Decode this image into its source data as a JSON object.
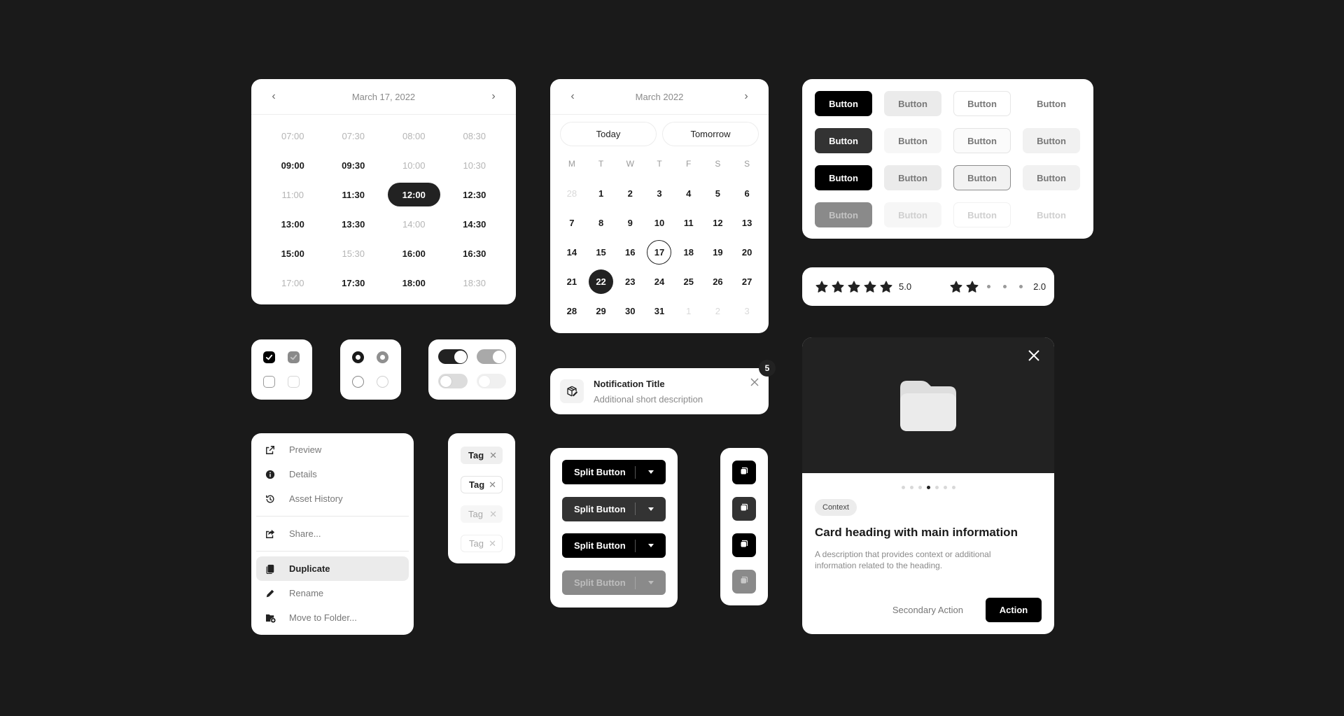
{
  "time_picker": {
    "title": "March 17, 2022",
    "prev_icon": "chevron-left-icon",
    "next_icon": "chevron-right-icon",
    "slots": [
      {
        "time": "07:00",
        "state": "unavailable"
      },
      {
        "time": "07:30",
        "state": "unavailable"
      },
      {
        "time": "08:00",
        "state": "unavailable"
      },
      {
        "time": "08:30",
        "state": "unavailable"
      },
      {
        "time": "09:00",
        "state": "available"
      },
      {
        "time": "09:30",
        "state": "available"
      },
      {
        "time": "10:00",
        "state": "unavailable"
      },
      {
        "time": "10:30",
        "state": "unavailable"
      },
      {
        "time": "11:00",
        "state": "unavailable"
      },
      {
        "time": "11:30",
        "state": "available"
      },
      {
        "time": "12:00",
        "state": "selected"
      },
      {
        "time": "12:30",
        "state": "available"
      },
      {
        "time": "13:00",
        "state": "available"
      },
      {
        "time": "13:30",
        "state": "available"
      },
      {
        "time": "14:00",
        "state": "unavailable"
      },
      {
        "time": "14:30",
        "state": "available"
      },
      {
        "time": "15:00",
        "state": "available"
      },
      {
        "time": "15:30",
        "state": "unavailable"
      },
      {
        "time": "16:00",
        "state": "available"
      },
      {
        "time": "16:30",
        "state": "available"
      },
      {
        "time": "17:00",
        "state": "unavailable"
      },
      {
        "time": "17:30",
        "state": "available"
      },
      {
        "time": "18:00",
        "state": "available"
      },
      {
        "time": "18:30",
        "state": "unavailable"
      }
    ]
  },
  "date_picker": {
    "title": "March 2022",
    "quick": [
      "Today",
      "Tomorrow"
    ],
    "weekdays": [
      "M",
      "T",
      "W",
      "T",
      "F",
      "S",
      "S"
    ],
    "days": [
      {
        "d": "28",
        "s": "muted"
      },
      {
        "d": "1"
      },
      {
        "d": "2"
      },
      {
        "d": "3"
      },
      {
        "d": "4"
      },
      {
        "d": "5"
      },
      {
        "d": "6"
      },
      {
        "d": "7"
      },
      {
        "d": "8"
      },
      {
        "d": "9"
      },
      {
        "d": "10"
      },
      {
        "d": "11"
      },
      {
        "d": "12"
      },
      {
        "d": "13"
      },
      {
        "d": "14"
      },
      {
        "d": "15"
      },
      {
        "d": "16"
      },
      {
        "d": "17",
        "s": "today"
      },
      {
        "d": "18"
      },
      {
        "d": "19"
      },
      {
        "d": "20"
      },
      {
        "d": "21"
      },
      {
        "d": "22",
        "s": "sel"
      },
      {
        "d": "23"
      },
      {
        "d": "24"
      },
      {
        "d": "25"
      },
      {
        "d": "26"
      },
      {
        "d": "27"
      },
      {
        "d": "28"
      },
      {
        "d": "29"
      },
      {
        "d": "30"
      },
      {
        "d": "31"
      },
      {
        "d": "1",
        "s": "muted"
      },
      {
        "d": "2",
        "s": "muted"
      },
      {
        "d": "3",
        "s": "muted"
      }
    ]
  },
  "button_grid": {
    "label": "Button",
    "rows": [
      [
        "primary",
        "secondary",
        "outline",
        "ghost"
      ],
      [
        "primary-hover",
        "secondary-hover",
        "outline-hover",
        "ghost-hover"
      ],
      [
        "primary",
        "secondary",
        "outline-active",
        "ghost-hover"
      ],
      [
        "primary-disabled",
        "secondary-disabled",
        "outline-disabled",
        "ghost-disabled"
      ]
    ]
  },
  "ratings": [
    {
      "value": 5,
      "max": 5,
      "label": "5.0"
    },
    {
      "value": 2,
      "max": 5,
      "label": "2.0"
    }
  ],
  "checkboxes": [
    "checked",
    "checked-disabled",
    "unchecked",
    "unchecked-disabled"
  ],
  "radios": [
    "selected",
    "selected-disabled",
    "unselected",
    "unselected-disabled"
  ],
  "toggles": [
    "on",
    "on-disabled",
    "off",
    "off-disabled"
  ],
  "notification": {
    "title": "Notification Title",
    "description": "Additional short description",
    "badge_count": "5",
    "icon": "package-edit-icon"
  },
  "context_menu": {
    "groups": [
      [
        {
          "label": "Preview",
          "icon": "external-link-icon"
        },
        {
          "label": "Details",
          "icon": "info-icon"
        },
        {
          "label": "Asset History",
          "icon": "history-icon"
        }
      ],
      [
        {
          "label": "Share...",
          "icon": "share-icon"
        }
      ],
      [
        {
          "label": "Duplicate",
          "icon": "duplicate-icon",
          "active": true
        },
        {
          "label": "Rename",
          "icon": "pencil-icon"
        },
        {
          "label": "Move to Folder...",
          "icon": "folder-move-icon"
        }
      ]
    ]
  },
  "tags": [
    {
      "label": "Tag",
      "variant": "filled"
    },
    {
      "label": "Tag",
      "variant": "outline"
    },
    {
      "label": "Tag",
      "variant": "filled-dis"
    },
    {
      "label": "Tag",
      "variant": "outline-dis"
    }
  ],
  "split_buttons": {
    "label": "Split Button",
    "variants": [
      "primary",
      "hover",
      "primary",
      "disabled"
    ]
  },
  "icon_buttons": {
    "icon": "copy-icon",
    "variants": [
      "primary",
      "hover",
      "primary",
      "disabled"
    ]
  },
  "card": {
    "media_icon": "folder-icon",
    "carousel": {
      "count": 7,
      "active": 4
    },
    "context": "Context",
    "heading": "Card heading with main information",
    "description": "A description that provides context or additional information related to the heading.",
    "secondary_action": "Secondary Action",
    "primary_action": "Action"
  }
}
